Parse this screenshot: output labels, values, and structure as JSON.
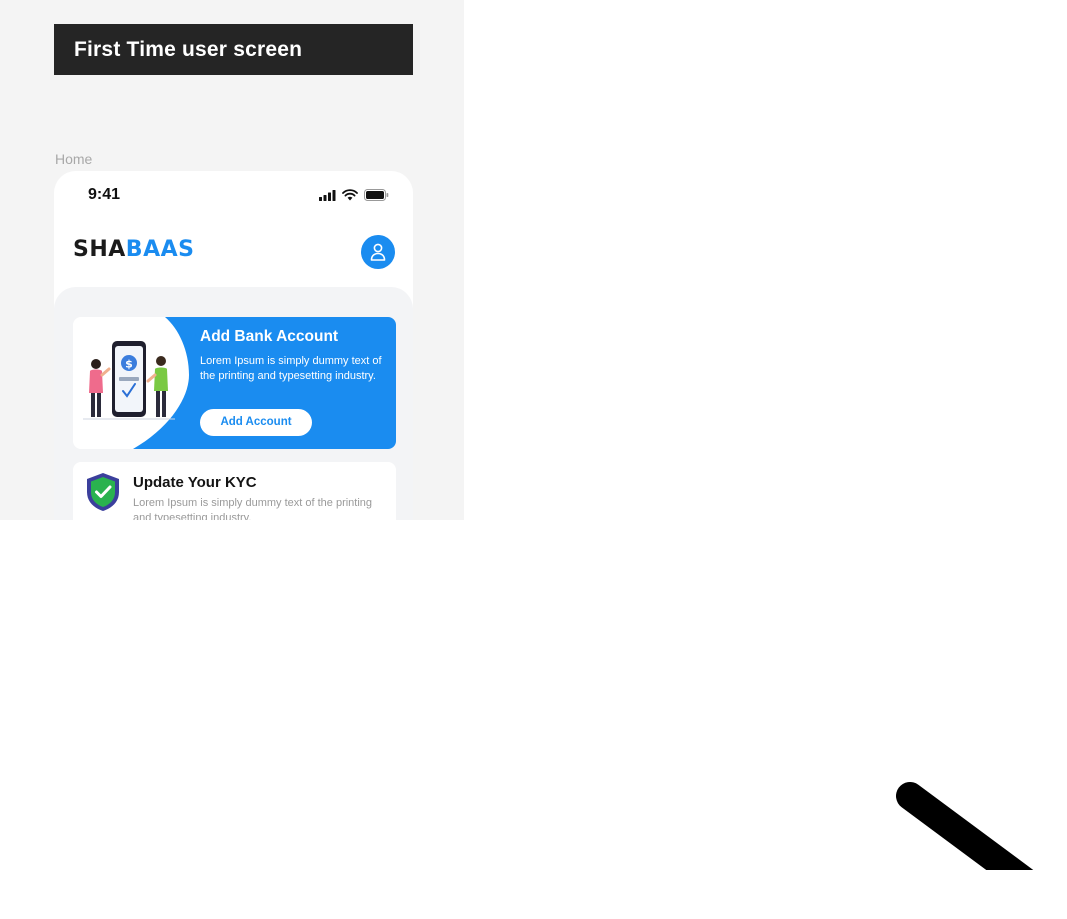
{
  "frame": {
    "title": "First Time user screen",
    "label": "Home"
  },
  "status_bar": {
    "time": "9:41",
    "icons": [
      "signal-icon",
      "wifi-icon",
      "battery-icon"
    ]
  },
  "header": {
    "logo_dark": "SHA",
    "logo_blue": "BAAS",
    "profile_icon": "user-icon"
  },
  "bank_card": {
    "title": "Add Bank Account",
    "description": "Lorem Ipsum is simply dummy text of the printing and typesetting industry.",
    "button_label": "Add Account"
  },
  "kyc_card": {
    "title": "Update Your KYC",
    "description": "Lorem Ipsum is simply dummy text of the printing and typesetting industry."
  },
  "colors": {
    "brand_blue": "#1a8cf0",
    "dark": "#1b1b1b",
    "title_bar": "#252525",
    "shield_green": "#2ab24f",
    "shield_border": "#3b3f9c"
  }
}
